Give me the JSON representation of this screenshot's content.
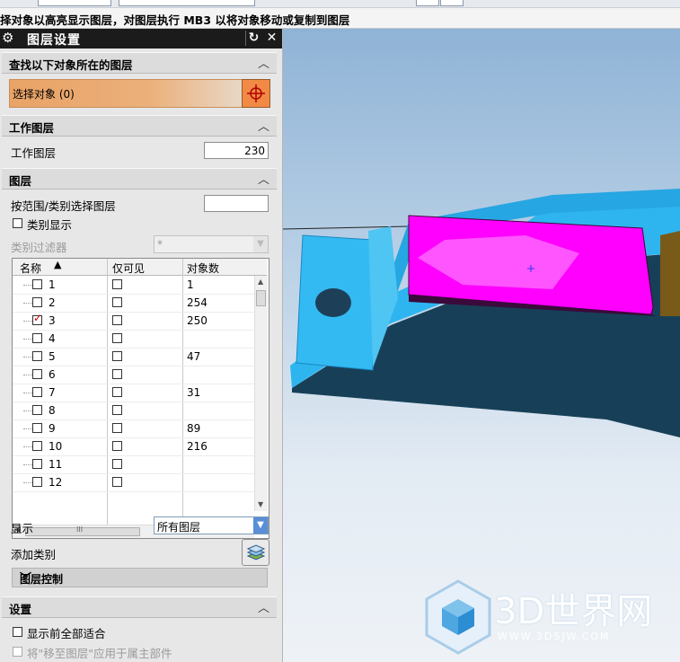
{
  "hint_text": "择对象以高亮显示图层，对图层执行 MB3 以将对象移动或复制到图层",
  "dialog": {
    "title": "图层设置",
    "sections": {
      "find": {
        "label": "查找以下对象所在的图层",
        "select_label": "选择对象 (0)"
      },
      "work": {
        "label": "工作图层",
        "work_layer_label": "工作图层",
        "work_layer_value": "230"
      },
      "layers": {
        "label": "图层",
        "range_label": "按范围/类别选择图层",
        "range_value": "",
        "category_display_label": "类别显示",
        "category_filter_label": "类别过滤器",
        "category_filter_value": "*",
        "table": {
          "headers": [
            "名称",
            "仅可见",
            "对象数"
          ],
          "rows": [
            {
              "name": "1",
              "count": "1",
              "checked": false
            },
            {
              "name": "2",
              "count": "254",
              "checked": false
            },
            {
              "name": "3",
              "count": "250",
              "checked": true
            },
            {
              "name": "4",
              "count": "",
              "checked": false
            },
            {
              "name": "5",
              "count": "47",
              "checked": false
            },
            {
              "name": "6",
              "count": "",
              "checked": false
            },
            {
              "name": "7",
              "count": "31",
              "checked": false
            },
            {
              "name": "8",
              "count": "",
              "checked": false
            },
            {
              "name": "9",
              "count": "89",
              "checked": false
            },
            {
              "name": "10",
              "count": "216",
              "checked": false
            },
            {
              "name": "11",
              "count": "",
              "checked": false
            },
            {
              "name": "12",
              "count": "",
              "checked": false
            }
          ],
          "hscroll_glyph": "III"
        },
        "display_label": "显示",
        "display_value": "所有图层",
        "add_category_label": "添加类别",
        "layer_control_label": "图层控制"
      },
      "settings": {
        "label": "设置",
        "fit_label": "显示前全部适合",
        "move_label": "将\"移至图层\"应用于属主部件"
      }
    }
  },
  "watermark": {
    "brand": "3D世界网",
    "url": "WWW.3DSJW.COM"
  },
  "colors": {
    "accent": "#f08a45",
    "magenta": "#ff00ff",
    "cyan": "#2eb5f0",
    "navy": "#174058"
  }
}
